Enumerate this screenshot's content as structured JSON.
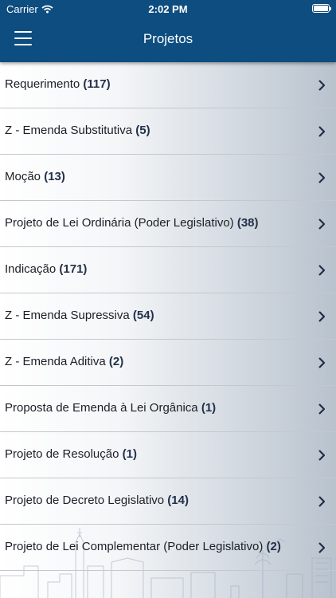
{
  "status_bar": {
    "carrier": "Carrier",
    "time": "2:02 PM",
    "battery_level": 1.0
  },
  "header": {
    "title": "Projetos",
    "menu_icon": "hamburger-menu-icon"
  },
  "projects": [
    {
      "label": "Requerimento",
      "count": "(117)"
    },
    {
      "label": "Z - Emenda Substitutiva",
      "count": "(5)"
    },
    {
      "label": "Moção",
      "count": "(13)"
    },
    {
      "label": "Projeto de Lei Ordinária (Poder Legislativo)",
      "count": "(38)"
    },
    {
      "label": "Indicação",
      "count": "(171)"
    },
    {
      "label": "Z - Emenda Supressiva",
      "count": "(54)"
    },
    {
      "label": "Z - Emenda Aditiva",
      "count": "(2)"
    },
    {
      "label": "Proposta de Emenda à Lei Orgânica",
      "count": "(1)"
    },
    {
      "label": "Projeto de Resolução",
      "count": "(1)"
    },
    {
      "label": "Projeto de Decreto Legislativo",
      "count": "(14)"
    },
    {
      "label": "Projeto de Lei Complementar (Poder Legislativo)",
      "count": "(2)"
    }
  ],
  "colors": {
    "header_bg": "#0d4d80",
    "text": "#1b1f26",
    "chevron": "#1e2d45"
  },
  "icons": {
    "row_action": "chevron-right-icon",
    "signal": "wifi-icon",
    "battery": "battery-icon"
  }
}
